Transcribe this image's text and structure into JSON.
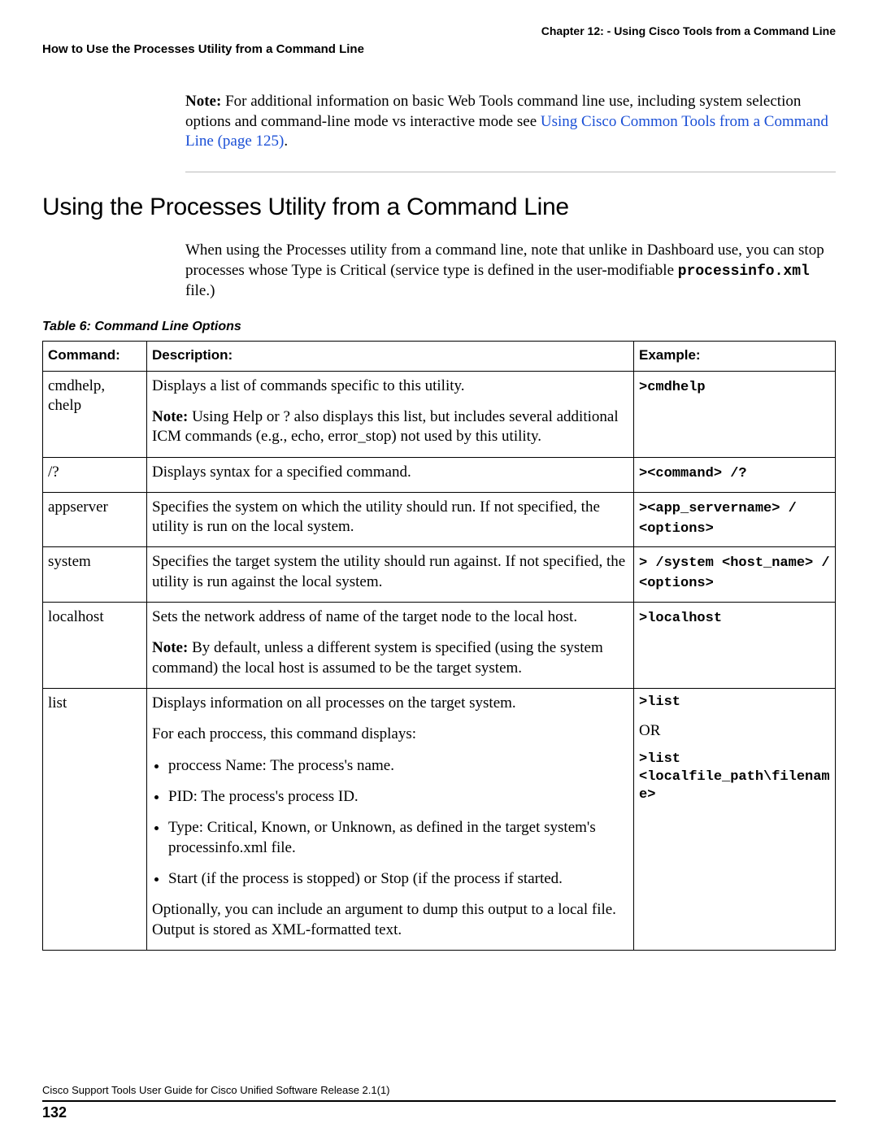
{
  "header": {
    "chapter": "Chapter 12: - Using Cisco Tools from a Command Line",
    "section": "How to Use the Processes Utility from a Command Line"
  },
  "note": {
    "label": "Note:",
    "before_link": " For additional information on basic Web Tools command line use, including system selection options and command-line mode vs interactive mode see ",
    "link_text": "Using Cisco Common Tools from a Command Line (page 125)",
    "after_link": "."
  },
  "section_title": "Using the Processes Utility from a Command Line",
  "intro": {
    "text_before_code": "When using the Processes utility from a command line, note that unlike in Dashboard use, you can stop processes whose Type is Critical (service type is defined in the user-modifiable ",
    "code": "processinfo.xml",
    "text_after_code": " file.)"
  },
  "table_caption": "Table 6: Command Line Options",
  "table": {
    "headers": {
      "command": "Command:",
      "description": "Description:",
      "example": "Example:"
    },
    "rows": [
      {
        "command": "cmdhelp, chelp",
        "desc_p1": "Displays a list of commands specific to this utility.",
        "desc_note_label": "Note:",
        "desc_note_text": " Using Help or ? also displays this list, but includes several additional ICM commands (e.g., echo, error_stop) not used by this utility.",
        "example_line1": ">cmdhelp"
      },
      {
        "command": "/?",
        "desc_p1": "Displays syntax for a specified command.",
        "example_line1": "><command> /?"
      },
      {
        "command": "appserver",
        "desc_p1": "Specifies the system on which the utility should run. If not specified, the utility is run on the local system.",
        "example_line1": "><app_servername> / <options>"
      },
      {
        "command": "system",
        "desc_p1": "Specifies the target system the utility should run against. If not specified, the utility is run against the local system.",
        "example_line1": "> /system <host_name> / <options>"
      },
      {
        "command": "localhost",
        "desc_p1": "Sets the network address of name of the target node to the local host.",
        "desc_note_label": "Note:",
        "desc_note_text": " By default, unless a different system is specified (using the system command) the local host is assumed to be the target system.",
        "example_line1": ">localhost"
      },
      {
        "command": "list",
        "desc_p1": "Displays information on all processes on the target system.",
        "desc_p2": "For each proccess, this command displays:",
        "bullets": [
          "proccess Name: The process's name.",
          "PID: The process's process ID.",
          "Type: Critical, Known, or Unknown, as defined in the target system's processinfo.xml file.",
          "Start (if the process is stopped) or Stop (if the process if started."
        ],
        "desc_p3": "Optionally, you can include an argument to dump this output to a local file. Output is stored as XML-formatted text.",
        "example_line1": ">list",
        "example_or": "OR",
        "example_line2": ">list <localfile_path\\filename>"
      }
    ]
  },
  "footer": {
    "guide": "Cisco Support Tools User Guide for Cisco Unified Software Release 2.1(1)",
    "page": "132"
  }
}
